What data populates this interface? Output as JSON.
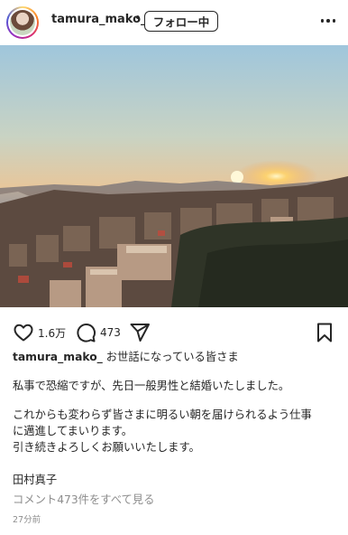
{
  "header": {
    "username": "tamura_mako_",
    "separator": "•",
    "follow_label": "フォロー中"
  },
  "actions": {
    "likes": "1.6万",
    "comments": "473"
  },
  "caption": {
    "username": "tamura_mako_",
    "first_line": "お世話になっている皆さま",
    "para1": "私事で恐縮ですが、先日一般男性と結婚いたしました。",
    "para2_line1": "これからも変わらず皆さまに明るい朝を届けられるよう仕事",
    "para2_line2": "に邁進してまいります。",
    "para2_line3": "引き続きよろしくお願いいたします。",
    "signature": "田村真子"
  },
  "view_comments": "コメント473件をすべて見る",
  "timestamp": "27分前",
  "icons": {
    "more": "more-options-icon",
    "like": "heart-icon",
    "comment": "comment-icon",
    "share": "share-icon",
    "save": "bookmark-icon"
  }
}
